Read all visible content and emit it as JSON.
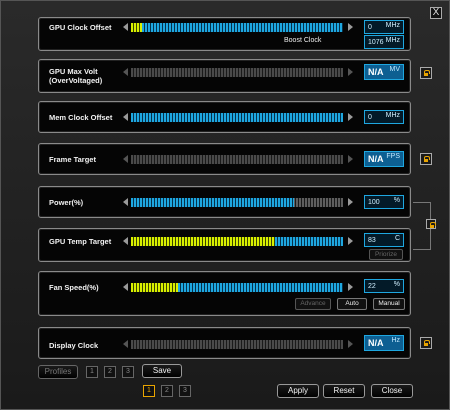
{
  "window": {
    "close_label": "X"
  },
  "rows": [
    {
      "id": "gpu-clock",
      "label": "GPU Clock Offset",
      "value": "0",
      "unit": "MHz",
      "fill": 0.05,
      "fill_color": "yellow",
      "extra_label": "Boost Clock",
      "extra_value": "1076",
      "extra_unit": "MHz"
    },
    {
      "id": "gpu-volt",
      "label_line1": "GPU Max Volt",
      "label_line2": "(OverVoltaged)",
      "value": "N/A",
      "unit": "MV",
      "fill": 0,
      "locked": true
    },
    {
      "id": "mem-clock",
      "label": "Mem Clock  Offset",
      "value": "0",
      "unit": "MHz",
      "fill": 1.0,
      "fill_color": "blue"
    },
    {
      "id": "frame-target",
      "label": "Frame Target",
      "value": "N/A",
      "unit": "FPS",
      "fill": 0,
      "locked": true
    },
    {
      "id": "power",
      "label": "Power(%)",
      "value": "100",
      "unit": "%",
      "fill": 0.77,
      "fill_color": "blue"
    },
    {
      "id": "gpu-temp",
      "label": "GPU Temp Target",
      "value": "83",
      "unit": "C",
      "fill": 0.68,
      "fill_color": "yellow",
      "button": "Priorize"
    },
    {
      "id": "fan",
      "label": "Fan Speed(%)",
      "value": "22",
      "unit": "%",
      "fill": 0.22,
      "fill_color": "yellow",
      "buttons": [
        "Advance",
        "Auto",
        "Manual"
      ]
    },
    {
      "id": "display-clock",
      "label": "Display Clock",
      "value": "N/A",
      "unit": "Hz",
      "fill": 0,
      "locked": true
    }
  ],
  "footer": {
    "profiles_label": "Profiles",
    "profile_slots": [
      "1",
      "2",
      "3"
    ],
    "save_label": "Save",
    "bank_slots": [
      "1",
      "2",
      "3"
    ],
    "active_bank": "1",
    "apply_label": "Apply",
    "reset_label": "Reset",
    "close_label": "Close"
  },
  "colors": {
    "accent_blue": "#1ea7e0",
    "accent_yellow": "#d8f000",
    "lock_orange": "#e8a400"
  }
}
